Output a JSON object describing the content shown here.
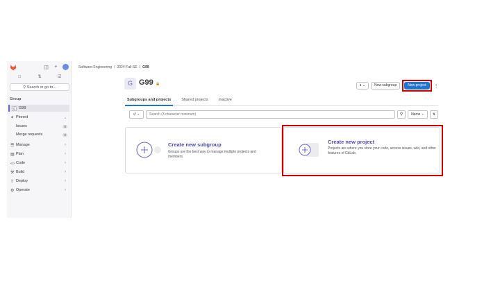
{
  "sidebar": {
    "section_label": "Group",
    "search_label": "Search or go to...",
    "group_item": {
      "badge": "G",
      "label": "G99"
    },
    "pinned": {
      "label": "Pinned"
    },
    "pinned_items": [
      {
        "label": "Issues",
        "count": "0"
      },
      {
        "label": "Merge requests",
        "count": "0"
      }
    ],
    "nav_items": [
      {
        "icon": "manage-icon",
        "glyph": "☰",
        "label": "Manage"
      },
      {
        "icon": "plan-icon",
        "glyph": "▤",
        "label": "Plan"
      },
      {
        "icon": "code-icon",
        "glyph": "</>",
        "label": "Code"
      },
      {
        "icon": "build-icon",
        "glyph": "⚒",
        "label": "Build"
      },
      {
        "icon": "deploy-icon",
        "glyph": "⇧",
        "label": "Deploy"
      },
      {
        "icon": "operate-icon",
        "glyph": "⚙",
        "label": "Operate"
      }
    ]
  },
  "breadcrumb": {
    "items": [
      "Software-Engineering",
      "/",
      "2024-Fall-SE",
      "/"
    ],
    "current": "G99"
  },
  "header": {
    "avatar_letter": "G",
    "title": "G99",
    "new_subgroup_label": "New subgroup",
    "new_project_label": "New project"
  },
  "tabs": [
    {
      "label": "Subgroups and projects",
      "active": true
    },
    {
      "label": "Shared projects",
      "active": false
    },
    {
      "label": "Inactive",
      "active": false
    }
  ],
  "filter": {
    "search_placeholder": "Search (3 character minimum)",
    "sort_label": "Name"
  },
  "cards": {
    "subgroup": {
      "title": "Create new subgroup",
      "description": "Groups are the best way to manage multiple projects and members."
    },
    "project": {
      "title": "Create new project",
      "description": "Projects are where you store your code, access issues, wiki, and other features of GitLab."
    }
  },
  "colors": {
    "primary": "#1f75cb",
    "highlight": "#d00000",
    "accent": "#6666c4"
  }
}
